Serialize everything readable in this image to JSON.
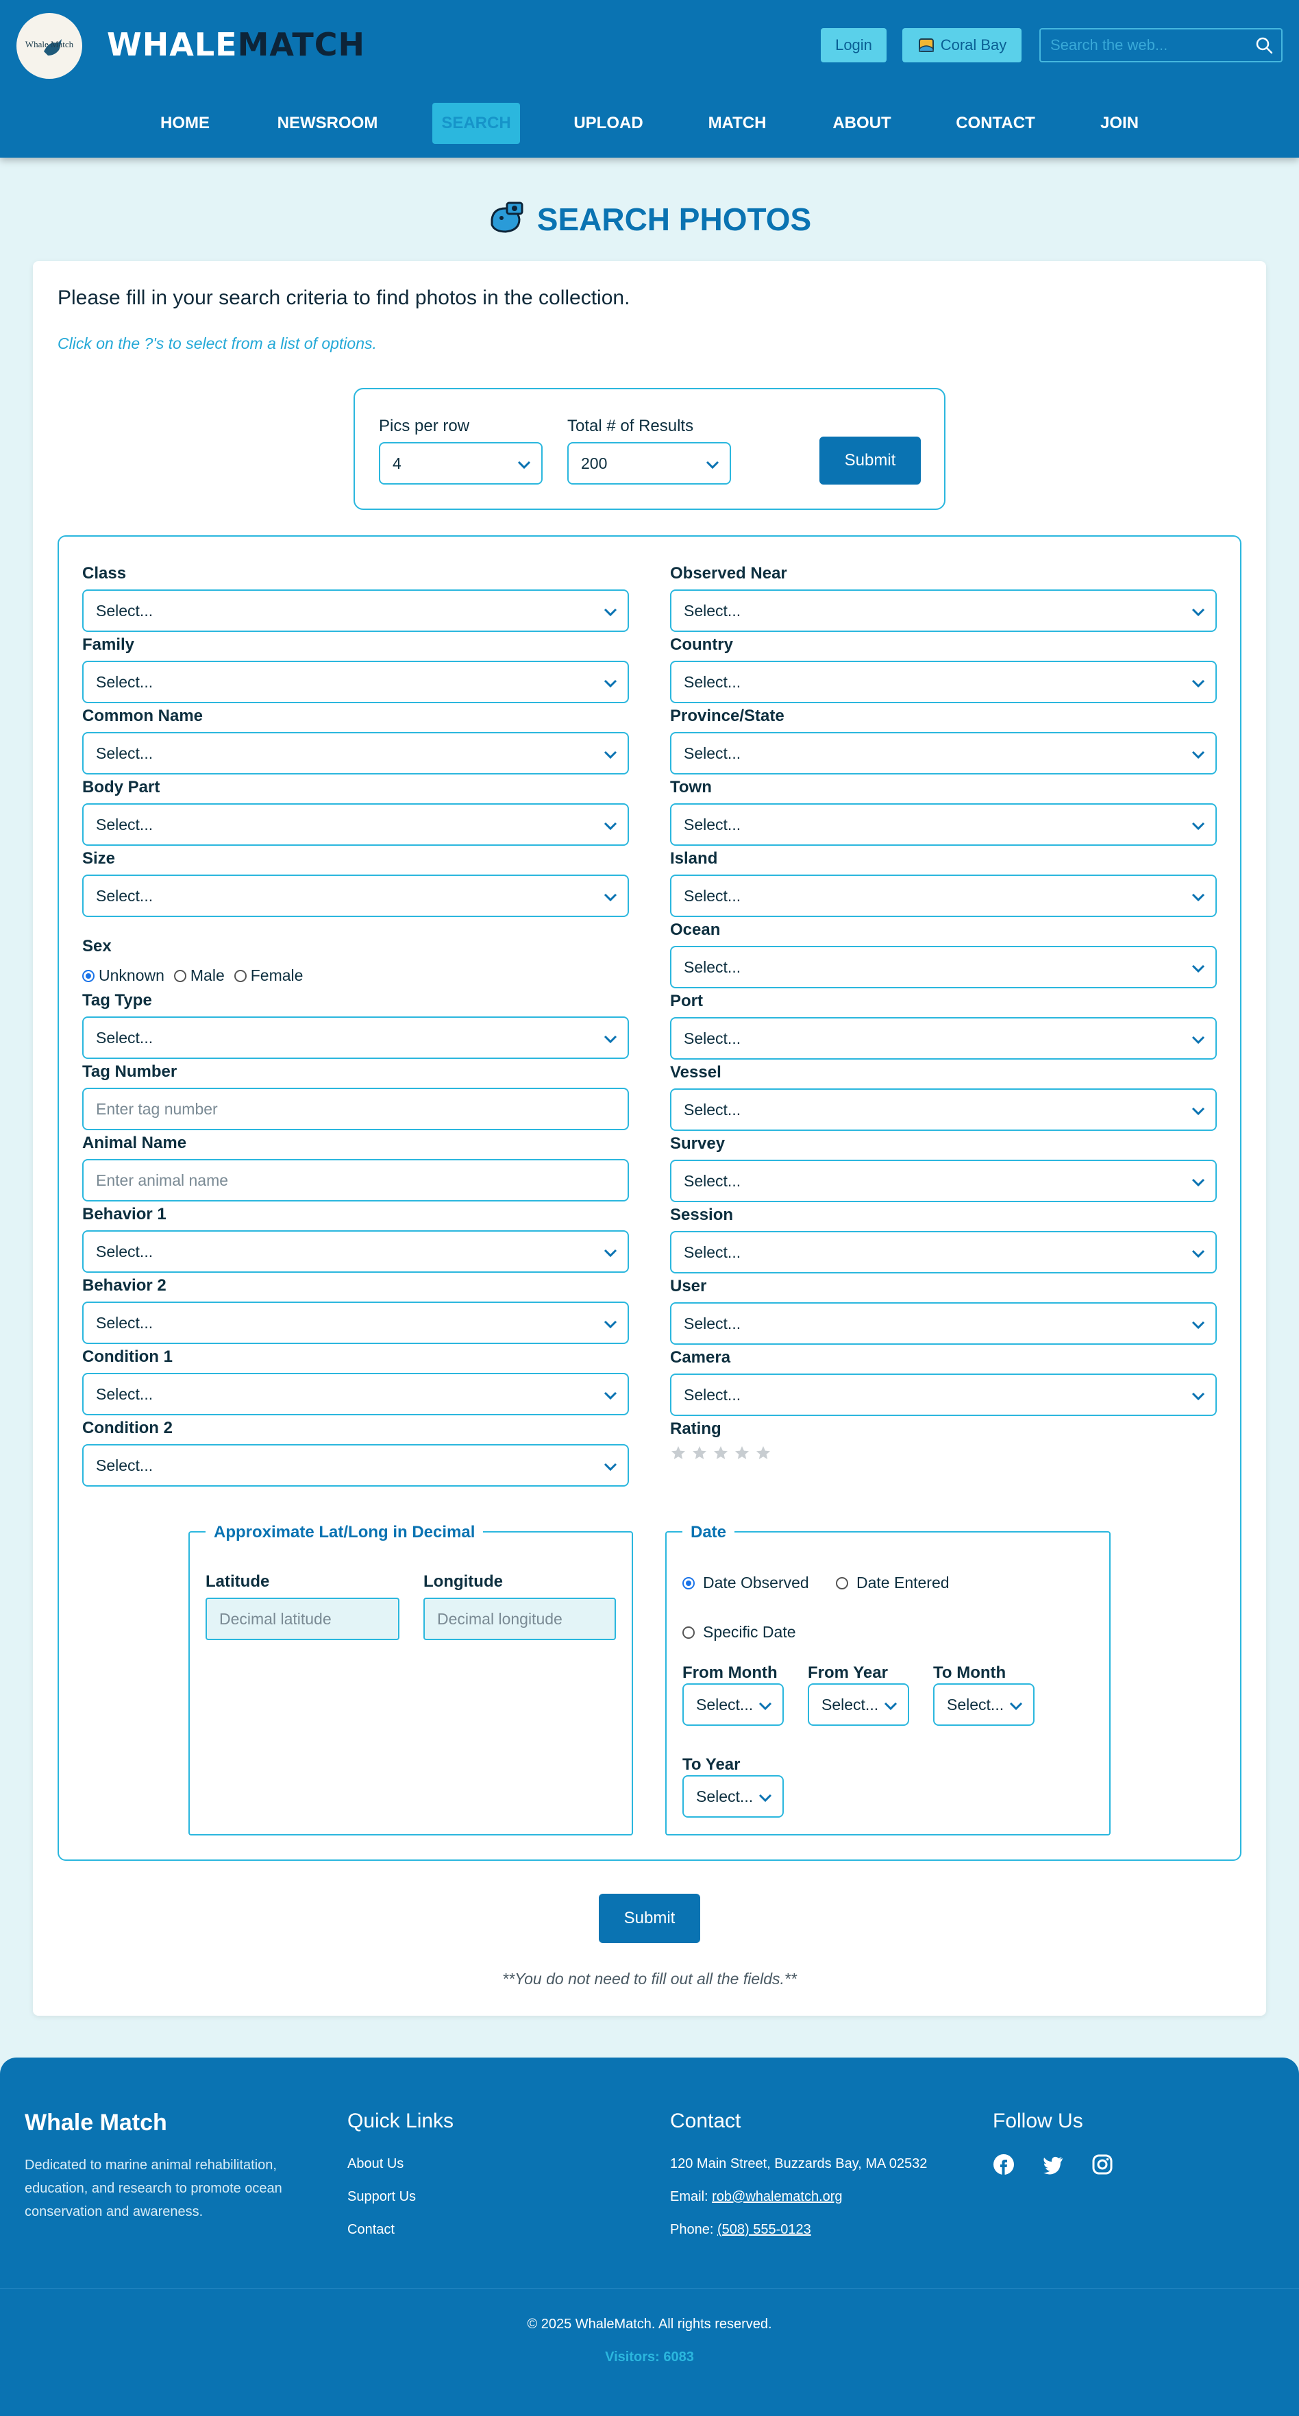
{
  "header": {
    "logo_text": "Whale Match",
    "brand_part1": "WHALE",
    "brand_part2": "MATCH",
    "login_label": "Login",
    "location_label": "Coral Bay",
    "search_placeholder": "Search the web...",
    "nav": [
      {
        "label": "HOME"
      },
      {
        "label": "NEWSROOM"
      },
      {
        "label": "SEARCH"
      },
      {
        "label": "UPLOAD"
      },
      {
        "label": "MATCH"
      },
      {
        "label": "ABOUT"
      },
      {
        "label": "CONTACT"
      },
      {
        "label": "JOIN"
      }
    ]
  },
  "page_title": "SEARCH PHOTOS",
  "intro": "Please fill in your search criteria to find photos in the collection.",
  "hint": "Click on the ?'s to select from a list of options.",
  "display_options": {
    "pics_per_row_label": "Pics per row",
    "pics_per_row_value": "4",
    "total_results_label": "Total # of Results",
    "total_results_value": "200",
    "submit_label": "Submit"
  },
  "left_fields": {
    "class": {
      "label": "Class",
      "value": "Select..."
    },
    "family": {
      "label": "Family",
      "value": "Select..."
    },
    "common_name": {
      "label": "Common Name",
      "value": "Select..."
    },
    "body_part": {
      "label": "Body Part",
      "value": "Select..."
    },
    "size": {
      "label": "Size",
      "value": "Select..."
    },
    "sex": {
      "label": "Sex",
      "options": [
        "Unknown",
        "Male",
        "Female"
      ],
      "selected": "Unknown"
    },
    "tag_type": {
      "label": "Tag Type",
      "value": "Select..."
    },
    "tag_number": {
      "label": "Tag Number",
      "placeholder": "Enter tag number"
    },
    "animal_name": {
      "label": "Animal Name",
      "placeholder": "Enter animal name"
    },
    "behavior1": {
      "label": "Behavior 1",
      "value": "Select..."
    },
    "behavior2": {
      "label": "Behavior 2",
      "value": "Select..."
    },
    "condition1": {
      "label": "Condition 1",
      "value": "Select..."
    },
    "condition2": {
      "label": "Condition 2",
      "value": "Select..."
    }
  },
  "right_fields": {
    "observed_near": {
      "label": "Observed Near",
      "value": "Select..."
    },
    "country": {
      "label": "Country",
      "value": "Select..."
    },
    "province": {
      "label": "Province/State",
      "value": "Select..."
    },
    "town": {
      "label": "Town",
      "value": "Select..."
    },
    "island": {
      "label": "Island",
      "value": "Select..."
    },
    "ocean": {
      "label": "Ocean",
      "value": "Select..."
    },
    "port": {
      "label": "Port",
      "value": "Select..."
    },
    "vessel": {
      "label": "Vessel",
      "value": "Select..."
    },
    "survey": {
      "label": "Survey",
      "value": "Select..."
    },
    "session": {
      "label": "Session",
      "value": "Select..."
    },
    "user": {
      "label": "User",
      "value": "Select..."
    },
    "camera": {
      "label": "Camera",
      "value": "Select..."
    },
    "rating": {
      "label": "Rating",
      "value": 0,
      "max": 5
    }
  },
  "latlong": {
    "legend": "Approximate Lat/Long in Decimal",
    "latitude_label": "Latitude",
    "latitude_placeholder": "Decimal latitude",
    "longitude_label": "Longitude",
    "longitude_placeholder": "Decimal longitude"
  },
  "date": {
    "legend": "Date",
    "options": [
      "Date Observed",
      "Date Entered",
      "Specific Date"
    ],
    "selected": "Date Observed",
    "from_month_label": "From Month",
    "from_month_value": "Select...",
    "from_year_label": "From Year",
    "from_year_value": "Select...",
    "to_month_label": "To Month",
    "to_month_value": "Select...",
    "to_year_label": "To Year",
    "to_year_value": "Select..."
  },
  "submit_label": "Submit",
  "note": "**You do not need to fill out all the fields.**",
  "footer": {
    "brand": "Whale Match",
    "description": "Dedicated to marine animal rehabilitation, education, and research to promote ocean conservation and awareness.",
    "quick_links_title": "Quick Links",
    "quick_links": [
      "About Us",
      "Support Us",
      "Contact"
    ],
    "contact_title": "Contact",
    "address": "120 Main Street, Buzzards Bay, MA 02532",
    "email_label": "Email:",
    "email": "rob@whalematch.org",
    "phone_label": "Phone:",
    "phone": "(508) 555-0123",
    "follow_title": "Follow Us",
    "social": [
      "facebook-icon",
      "twitter-icon",
      "instagram-icon"
    ],
    "copyright": "© 2025 WhaleMatch. All rights reserved.",
    "visitors": "Visitors: 6083"
  },
  "colors": {
    "primary": "#0a73b2",
    "accent": "#2bb7de",
    "background": "#e3f4f7"
  }
}
